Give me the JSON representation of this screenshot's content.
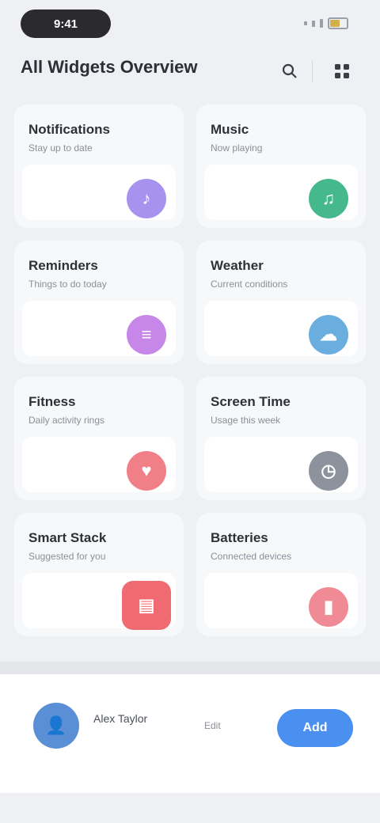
{
  "status_bar": {
    "time": "9:41"
  },
  "header": {
    "title": "All Widgets Overview",
    "search_icon": "search-icon",
    "more_icon": "grid-icon"
  },
  "cards": [
    {
      "title": "Notifications",
      "subtitle": "Stay up to date",
      "icon": "bell-icon",
      "color": "#a892f0"
    },
    {
      "title": "Music",
      "subtitle": "Now playing",
      "icon": "music-icon",
      "color": "#45b88e"
    },
    {
      "title": "Reminders",
      "subtitle": "Things to do today",
      "icon": "list-icon",
      "color": "#c687e8"
    },
    {
      "title": "Weather",
      "subtitle": "Current conditions",
      "icon": "cloud-icon",
      "color": "#6aaee0"
    },
    {
      "title": "Fitness",
      "subtitle": "Daily activity rings",
      "icon": "heart-icon",
      "color": "#f07f88"
    },
    {
      "title": "Screen Time",
      "subtitle": "Usage this week",
      "icon": "clock-icon",
      "color": "#8d939c"
    },
    {
      "title": "Smart Stack",
      "subtitle": "Suggested for you",
      "icon": "stack-icon",
      "color": "#f06a72"
    },
    {
      "title": "Batteries",
      "subtitle": "Connected devices",
      "icon": "battery-icon",
      "color": "#f08a95"
    }
  ],
  "footer": {
    "user_name": "Alex Taylor",
    "user_meta": "Edit",
    "cta_label": "Add",
    "avatar_color": "#5a8fd6",
    "cta_color": "#4a90f0"
  }
}
